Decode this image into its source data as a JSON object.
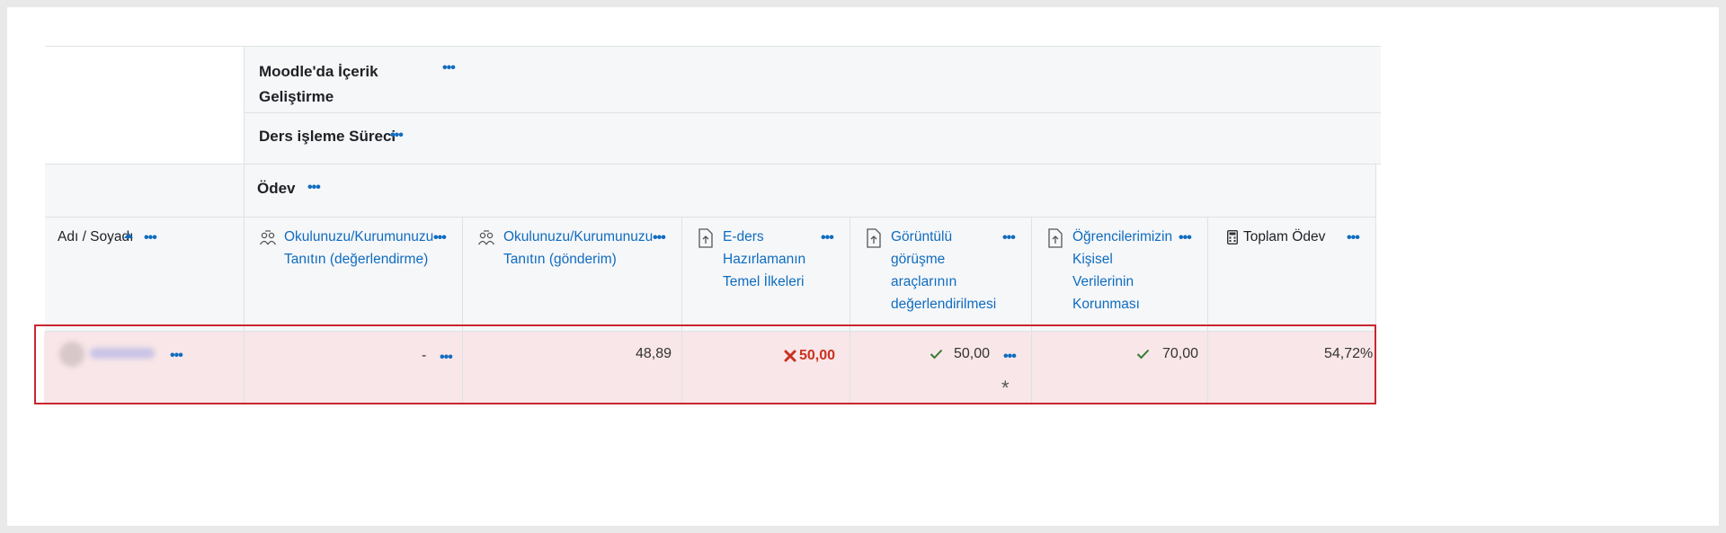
{
  "categories": {
    "top": "Moodle'da İçerik Geliştirme",
    "sub": "Ders işleme Süreci",
    "group": "Ödev"
  },
  "menu_label": "•••",
  "columns": {
    "name": "Adı / Soyadı",
    "c1": [
      "Okulunuzu/Kurumunuzu",
      "Tanıtın (değerlendirme)"
    ],
    "c2": [
      "Okulunuzu/Kurumunuzu",
      "Tanıtın (gönderim)"
    ],
    "c3": [
      "E-ders",
      "Hazırlamanın",
      "Temel İlkeleri"
    ],
    "c4": [
      "Görüntülü",
      "görüşme",
      "araçlarının",
      "değerlendirilmesi"
    ],
    "c5": [
      "Öğrencilerimizin",
      "Kişisel",
      "Verilerinin",
      "Korunması"
    ],
    "c6": "Toplam Ödev"
  },
  "row": {
    "c1": "-",
    "c2": "48,89",
    "c3": "50,00",
    "c4": "50,00",
    "c4_flag": "*",
    "c5": "70,00",
    "c6": "54,72%"
  },
  "colors": {
    "link": "#0f6cbf",
    "fail": "#ca3120",
    "pass": "#357a32",
    "highlight_border": "#c9262e",
    "highlight_bg": "#f8e6e8"
  },
  "icons": {
    "sort": "sort-ascending-icon",
    "workshop": "workshop-icon",
    "assign": "assignment-upload-icon",
    "total": "calculator-icon",
    "fail": "cross-icon",
    "pass": "check-icon"
  }
}
